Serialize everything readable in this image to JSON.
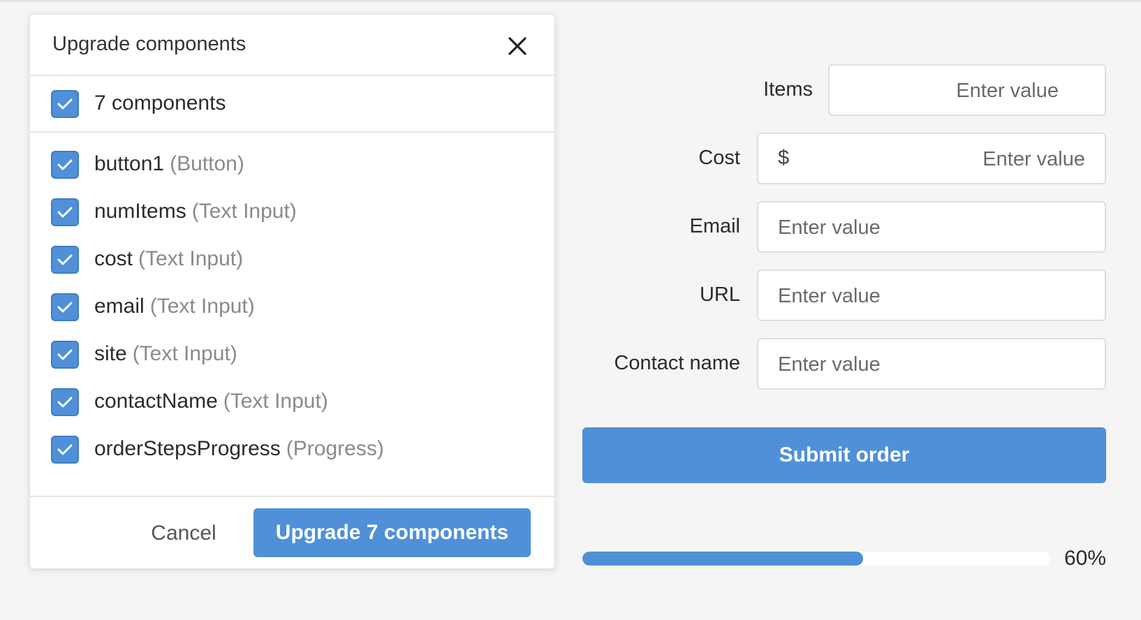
{
  "modal": {
    "title": "Upgrade components",
    "select_all_label": "7 components",
    "items": [
      {
        "name": "button1",
        "type": "(Button)"
      },
      {
        "name": "numItems",
        "type": "(Text Input)"
      },
      {
        "name": "cost",
        "type": "(Text Input)"
      },
      {
        "name": "email",
        "type": "(Text Input)"
      },
      {
        "name": "site",
        "type": "(Text Input)"
      },
      {
        "name": "contactName",
        "type": "(Text Input)"
      },
      {
        "name": "orderStepsProgress",
        "type": "(Progress)"
      }
    ],
    "cancel_label": "Cancel",
    "upgrade_label": "Upgrade 7 components",
    "icons": {
      "close": "close-icon",
      "check": "checkmark-icon"
    }
  },
  "form": {
    "items": {
      "label": "Items",
      "placeholder": "Enter value"
    },
    "cost": {
      "label": "Cost",
      "prefix": "$",
      "placeholder": "Enter value"
    },
    "email": {
      "label": "Email",
      "placeholder": "Enter value"
    },
    "url": {
      "label": "URL",
      "placeholder": "Enter value"
    },
    "contact_name": {
      "label": "Contact name",
      "placeholder": "Enter value"
    },
    "submit_label": "Submit order",
    "progress": {
      "value": 60,
      "label": "60%"
    }
  },
  "colors": {
    "accent": "#4f90d9",
    "background": "#f5f5f5"
  }
}
